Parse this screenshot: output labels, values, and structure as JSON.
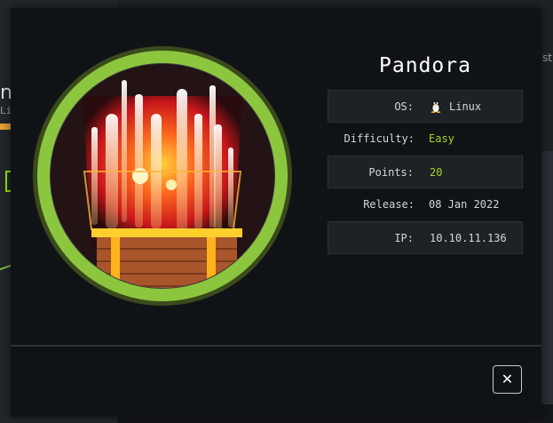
{
  "background": {
    "title_fragment": "n",
    "subtitle_fragment": "Li",
    "right_text_fragment": "st"
  },
  "machine": {
    "name": "Pandora",
    "info": [
      {
        "label": "OS:",
        "value": "Linux",
        "icon": "tux-icon",
        "style": "plain"
      },
      {
        "label": "Difficulty:",
        "value": "Easy",
        "style": "green"
      },
      {
        "label": "Points:",
        "value": "20",
        "style": "green"
      },
      {
        "label": "Release:",
        "value": "08 Jan 2022",
        "style": "plain"
      },
      {
        "label": "IP:",
        "value": "10.10.11.136",
        "style": "plain"
      }
    ]
  },
  "close_button": {
    "label": "✕"
  },
  "colors": {
    "modal_bg": "#101316",
    "accent_green": "#a4d325",
    "ring_green": "#8cc63e",
    "text": "#d3d7db"
  }
}
